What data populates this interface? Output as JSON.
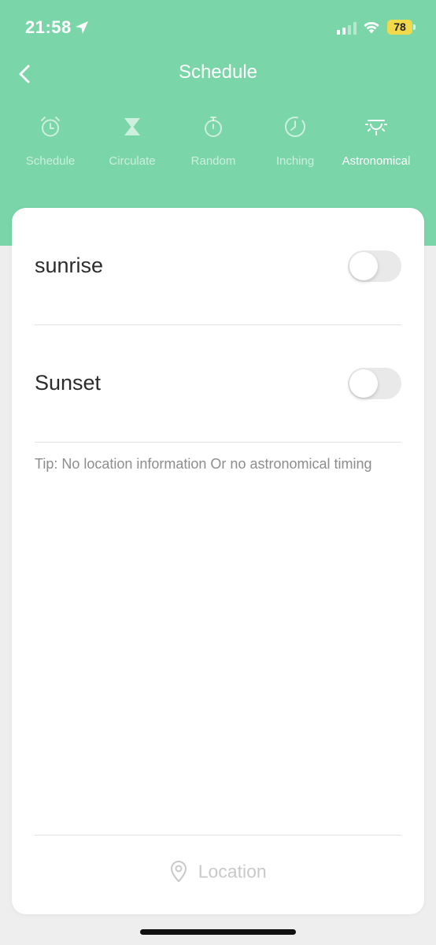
{
  "status_bar": {
    "time": "21:58",
    "battery": "78",
    "icons": [
      "location-arrow-icon",
      "signal-icon",
      "wifi-icon",
      "battery-icon"
    ]
  },
  "nav": {
    "title": "Schedule",
    "back_icon": "chevron-left-icon"
  },
  "tabs": [
    {
      "label": "Schedule",
      "icon": "alarm-clock-icon",
      "active": false
    },
    {
      "label": "Circulate",
      "icon": "hourglass-icon",
      "active": false
    },
    {
      "label": "Random",
      "icon": "stopwatch-icon",
      "active": false
    },
    {
      "label": "Inching",
      "icon": "timer-icon",
      "active": false
    },
    {
      "label": "Astronomical",
      "icon": "sunrise-icon",
      "active": true
    }
  ],
  "rows": [
    {
      "label": "sunrise",
      "enabled": false
    },
    {
      "label": "Sunset",
      "enabled": false
    }
  ],
  "tip": "Tip: No location information Or no astronomical timing",
  "location_button": {
    "label": "Location",
    "icon": "map-pin-icon"
  },
  "colors": {
    "header": "#7ad5a8",
    "background": "#eeeeee",
    "card": "#ffffff",
    "battery": "#f2d94b"
  }
}
